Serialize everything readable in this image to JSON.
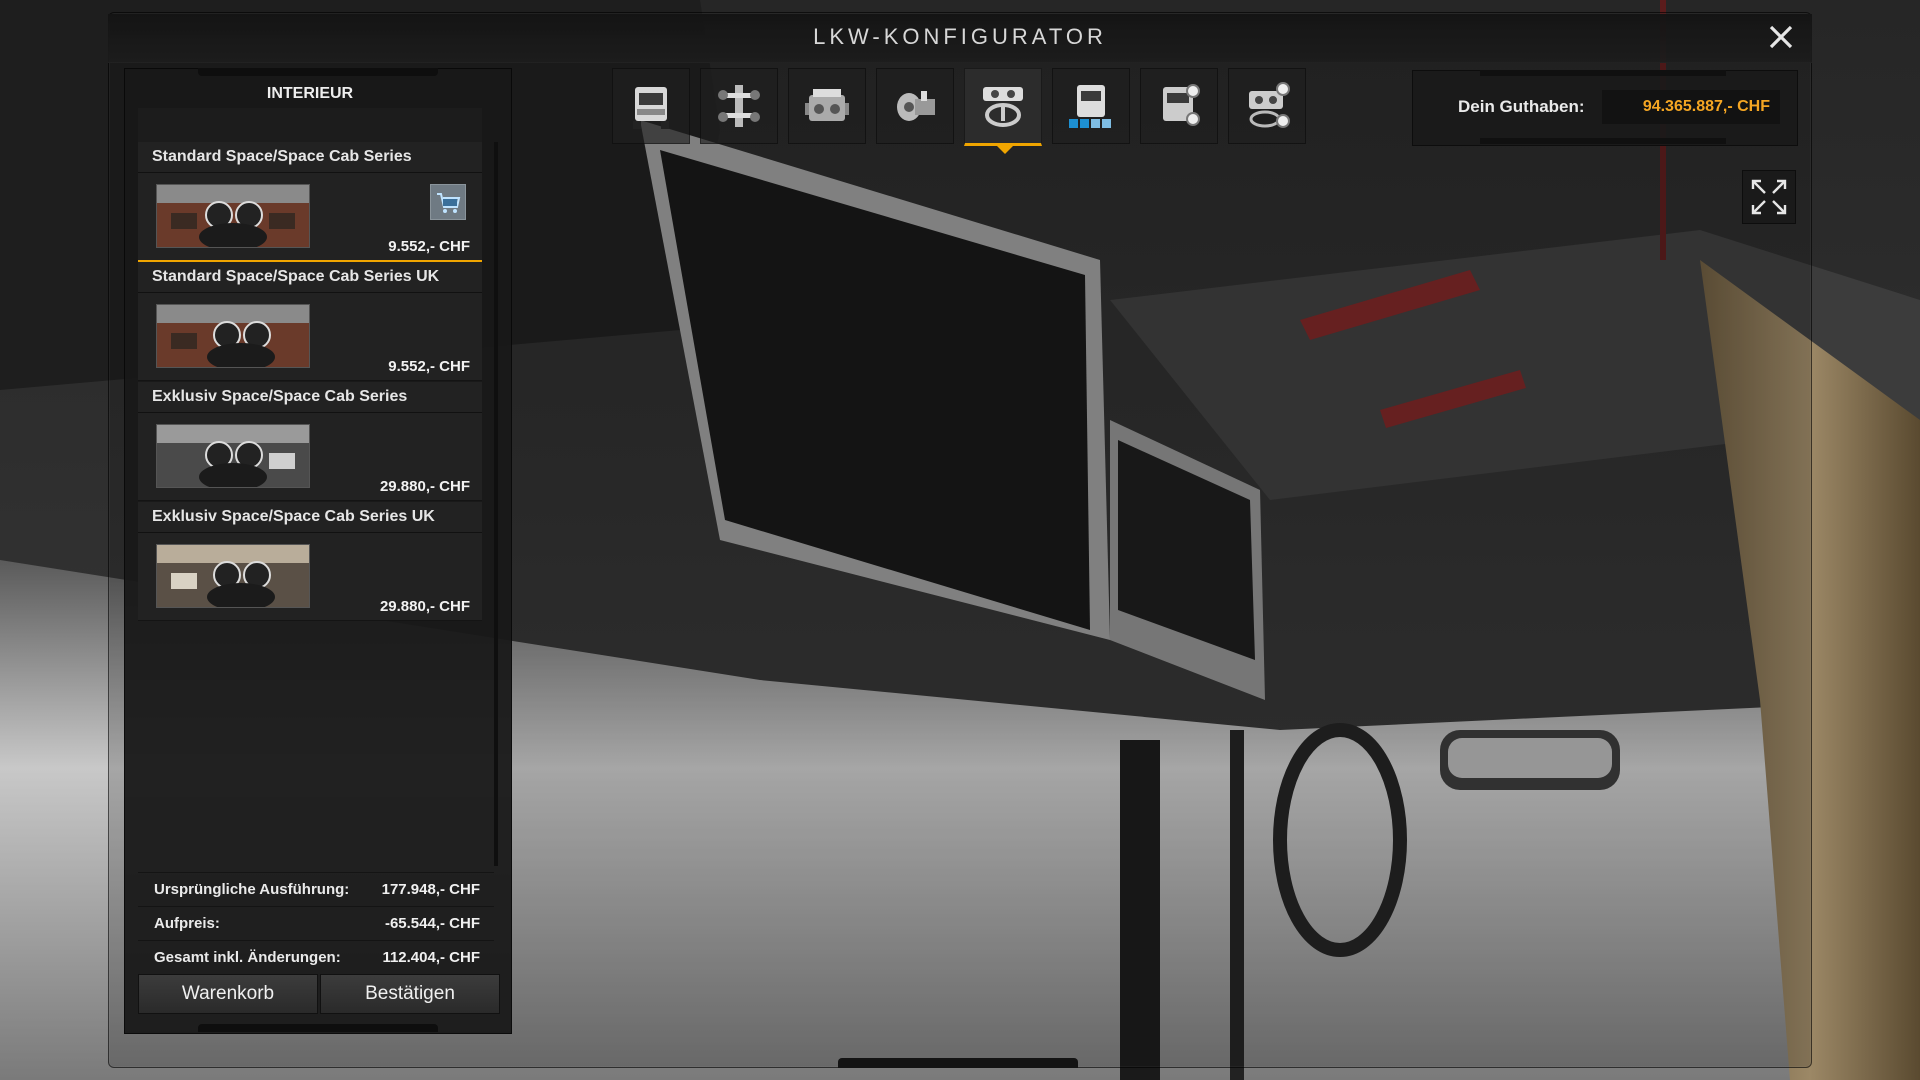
{
  "window": {
    "title": "LKW-KONFIGURATOR"
  },
  "category": {
    "title": "INTERIEUR"
  },
  "items": [
    {
      "name": "Standard Space/Space Cab Series",
      "price": "9.552,- CHF",
      "selected": true,
      "in_cart": true
    },
    {
      "name": "Standard Space/Space Cab Series UK",
      "price": "9.552,- CHF",
      "selected": false,
      "in_cart": false
    },
    {
      "name": "Exklusiv Space/Space Cab Series",
      "price": "29.880,- CHF",
      "selected": false,
      "in_cart": false
    },
    {
      "name": "Exklusiv Space/Space Cab Series UK",
      "price": "29.880,- CHF",
      "selected": false,
      "in_cart": false
    }
  ],
  "totals": {
    "original_label": "Ursprüngliche Ausführung:",
    "original_value": "177.948,- CHF",
    "surcharge_label": "Aufpreis:",
    "surcharge_value": "-65.544,- CHF",
    "total_label": "Gesamt inkl. Änderungen:",
    "total_value": "112.404,- CHF"
  },
  "buttons": {
    "cart": "Warenkorb",
    "confirm": "Bestätigen"
  },
  "credit": {
    "label": "Dein Guthaben:",
    "value": "94.365.887,- CHF"
  },
  "toolbar": {
    "icons": [
      "truck-icon",
      "chassis-icon",
      "engine-icon",
      "transmission-icon",
      "interior-icon",
      "cabin-icon",
      "paint-icon",
      "accessories-icon"
    ],
    "active": "interior-icon"
  },
  "colors": {
    "accent": "#f0a500",
    "credit_value": "#f5a623"
  }
}
